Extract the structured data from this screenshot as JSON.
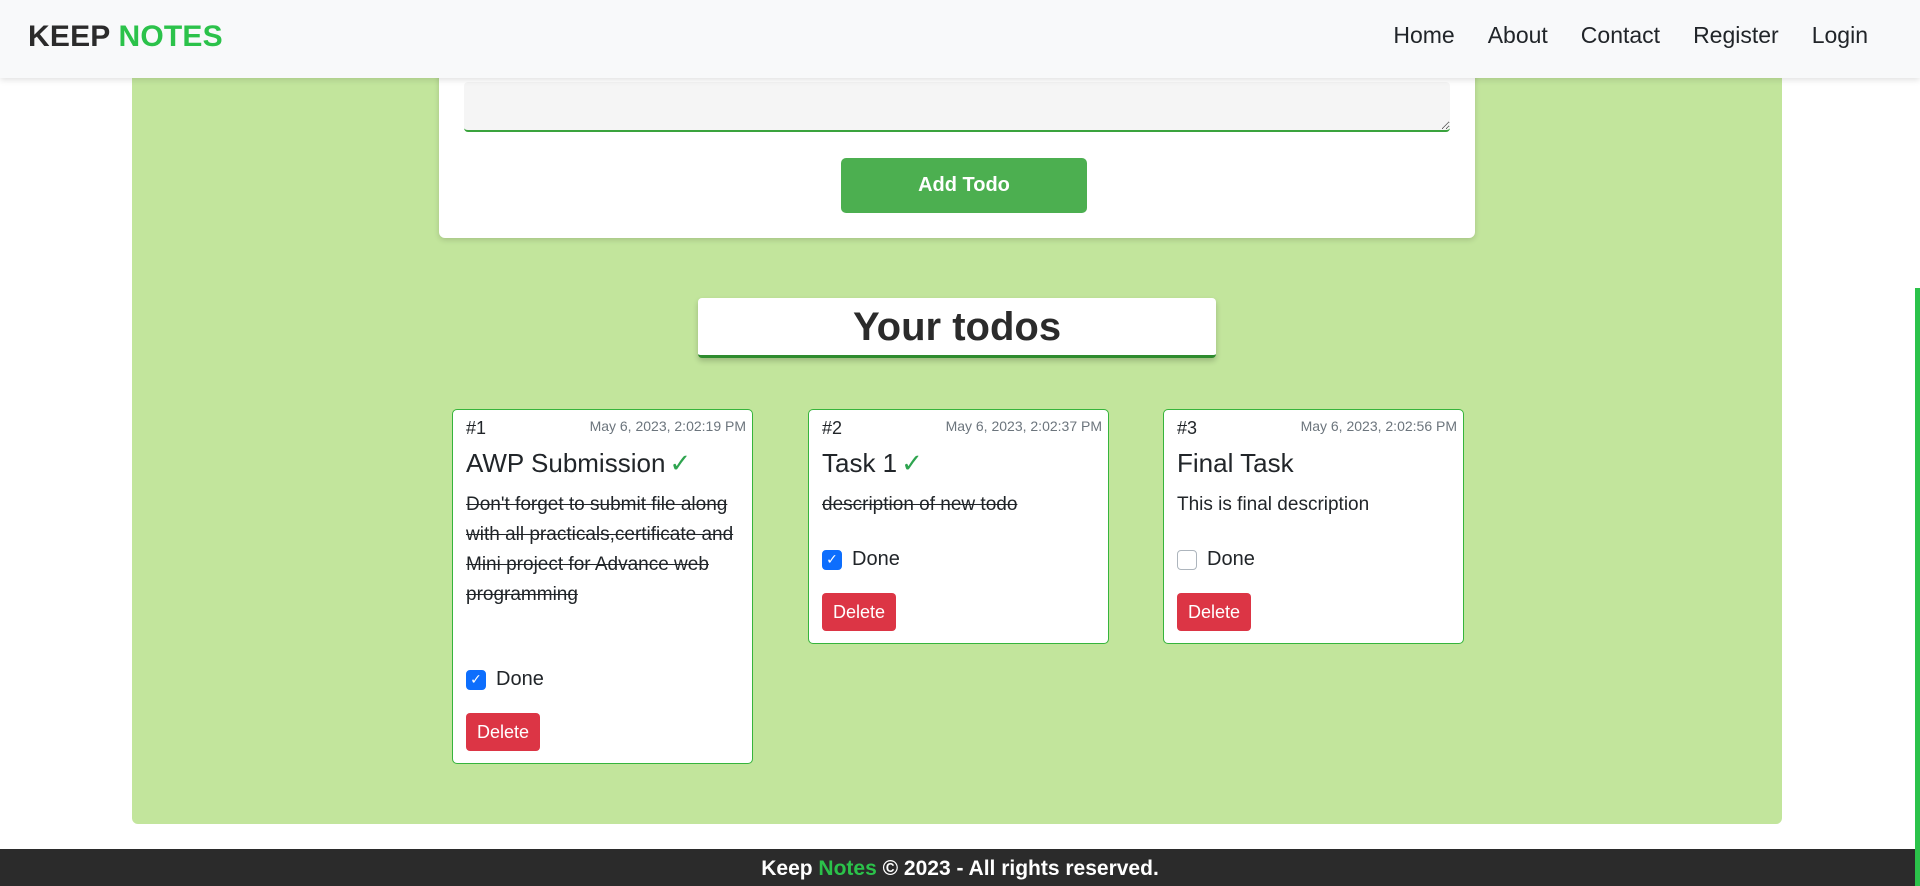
{
  "brand": {
    "part1": "KEEP",
    "part2": "NOTES"
  },
  "nav": {
    "items": [
      "Home",
      "About",
      "Contact",
      "Register",
      "Login"
    ]
  },
  "form": {
    "description_value": "",
    "add_button": "Add Todo"
  },
  "todos_heading": "Your todos",
  "todos": [
    {
      "num": "#1",
      "date": "May 6, 2023, 2:02:19 PM",
      "title": "AWP Submission",
      "completed": true,
      "description": "Don't forget to submit file along with all practicals,certificate and Mini project for Advance web programming",
      "done_label": "Done",
      "delete_label": "Delete"
    },
    {
      "num": "#2",
      "date": "May 6, 2023, 2:02:37 PM",
      "title": "Task 1",
      "completed": true,
      "description": "description of new todo",
      "done_label": "Done",
      "delete_label": "Delete"
    },
    {
      "num": "#3",
      "date": "May 6, 2023, 2:02:56 PM",
      "title": "Final Task",
      "completed": false,
      "description": "This is final description",
      "done_label": "Done",
      "delete_label": "Delete"
    }
  ],
  "footer": {
    "part1": "Keep",
    "part2": "Notes",
    "part3": "© 2023 - All rights reserved."
  },
  "colors": {
    "accent": "#2bc24a",
    "section_bg": "#c2e59c",
    "add_button": "#4caf50",
    "delete_button": "#dc3545",
    "checkbox": "#0d6efd"
  },
  "icons": {
    "done_check": "check-icon"
  }
}
